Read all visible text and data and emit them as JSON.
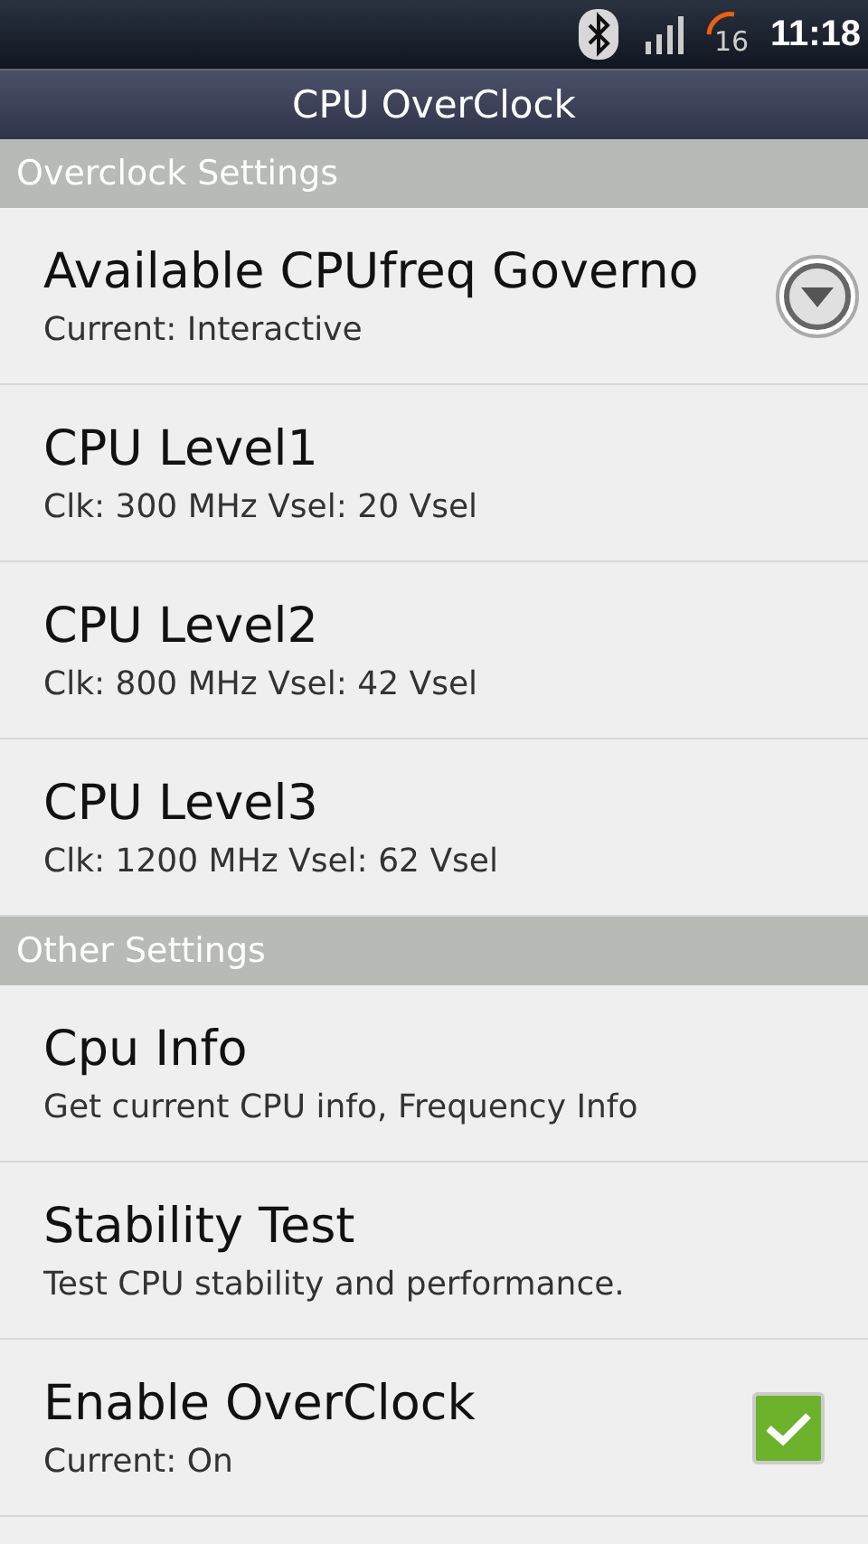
{
  "status_bar": {
    "battery": "16",
    "time": "11:18"
  },
  "title_bar": {
    "title": "CPU OverClock"
  },
  "sections": [
    {
      "header": "Overclock Settings",
      "items": [
        {
          "kind": "dropdown",
          "title": "Available CPUfreq Governo",
          "summary": "Current: Interactive"
        },
        {
          "kind": "plain",
          "title": "CPU Level1",
          "summary": "Clk: 300 MHz Vsel: 20 Vsel"
        },
        {
          "kind": "plain",
          "title": "CPU Level2",
          "summary": "Clk: 800 MHz Vsel: 42 Vsel"
        },
        {
          "kind": "plain",
          "title": "CPU Level3",
          "summary": "Clk: 1200 MHz Vsel: 62 Vsel"
        }
      ]
    },
    {
      "header": "Other Settings",
      "items": [
        {
          "kind": "plain",
          "title": "Cpu Info",
          "summary": "Get current CPU info, Frequency Info"
        },
        {
          "kind": "plain",
          "title": "Stability Test",
          "summary": "Test CPU stability and performance."
        },
        {
          "kind": "checkbox",
          "title": "Enable OverClock",
          "summary": "Current: On",
          "checked": true
        }
      ]
    }
  ]
}
